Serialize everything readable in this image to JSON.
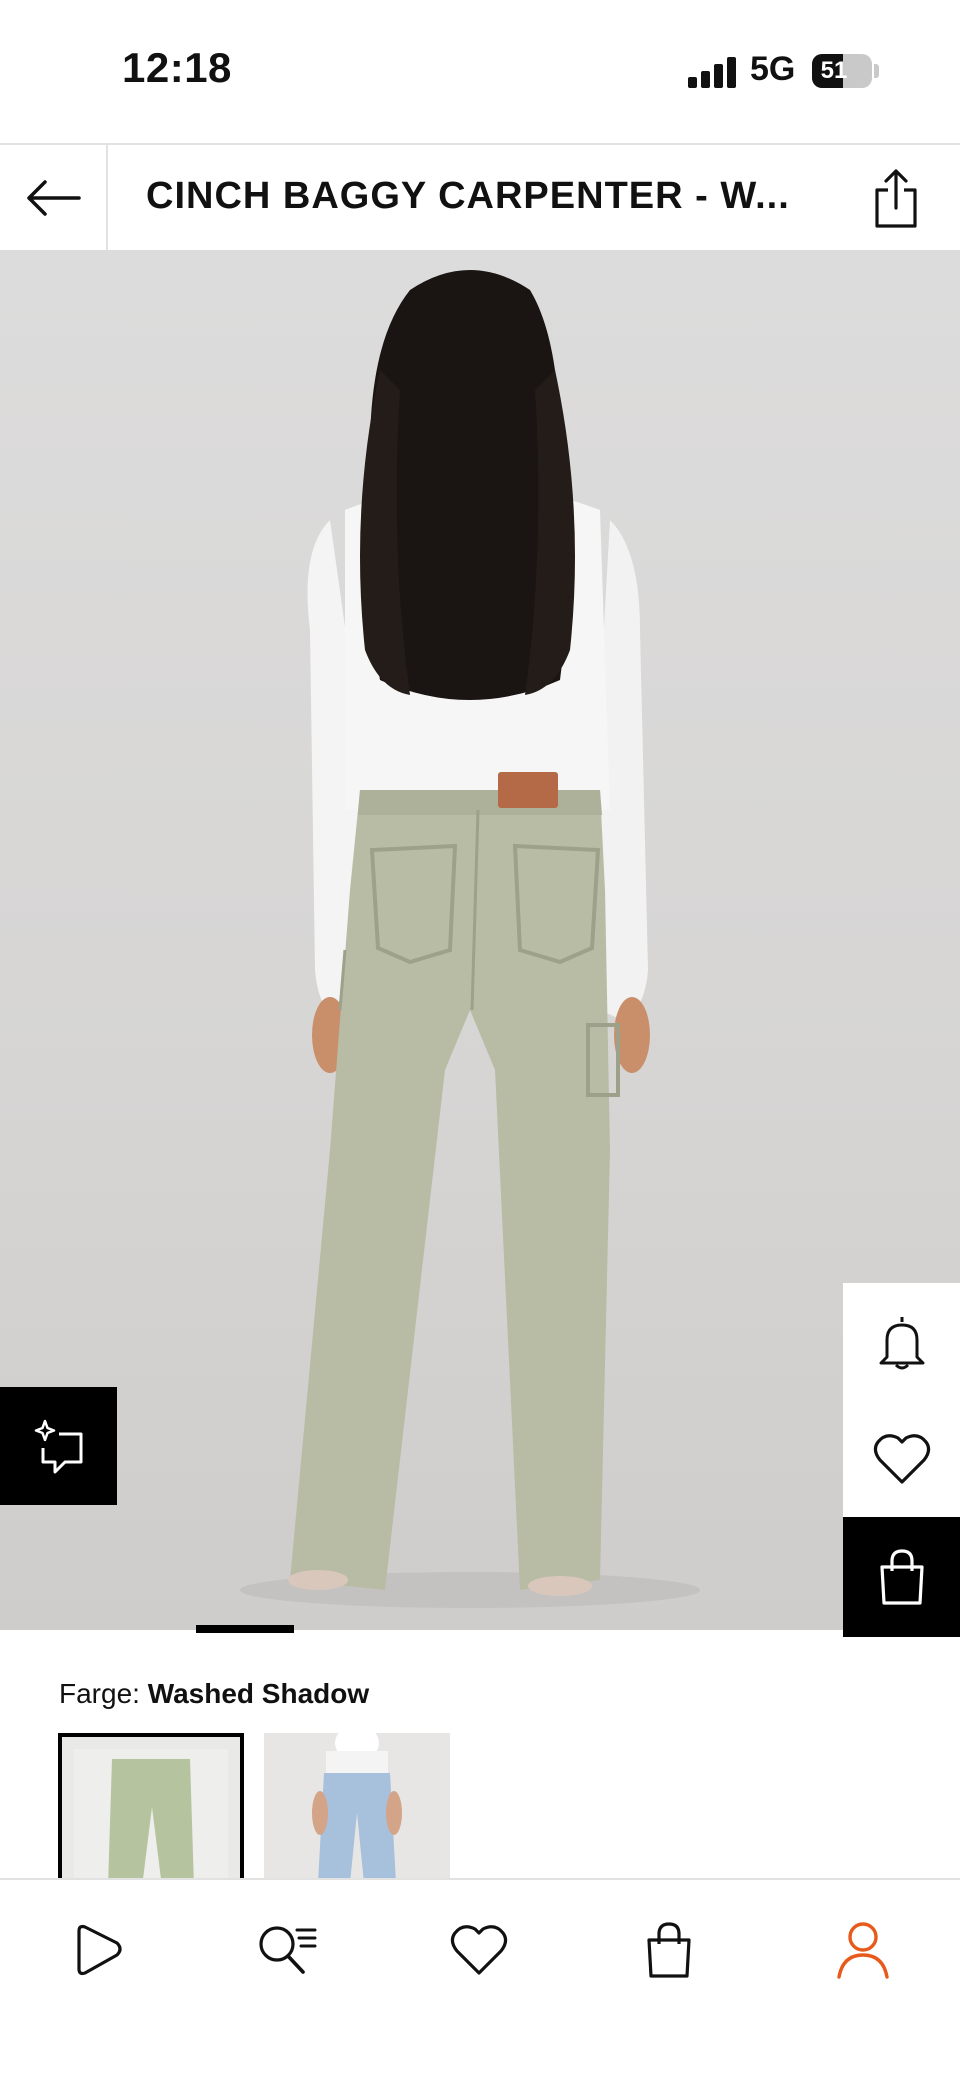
{
  "status_bar": {
    "time": "12:18",
    "network": "5G",
    "battery": "51",
    "battery_level": 0.51,
    "icons": [
      "signal-icon",
      "battery-icon"
    ]
  },
  "header": {
    "title": "CINCH BAGGY CARPENTER - W...",
    "icons": [
      "back-arrow-icon",
      "share-icon"
    ]
  },
  "gallery": {
    "image_index": 1,
    "image_count": 6
  },
  "side_actions": {
    "icons": [
      "bell-icon",
      "heart-icon",
      "shopping-bag-icon"
    ]
  },
  "compare": {
    "icon": "sparkle-compare-icon"
  },
  "color": {
    "label": "Farge:",
    "value": "Washed Shadow",
    "swatches": [
      {
        "selected": true
      },
      {
        "selected": false
      }
    ]
  },
  "bottom_nav": {
    "items": [
      {
        "icon": "play-icon"
      },
      {
        "icon": "search-list-icon"
      },
      {
        "icon": "heart-icon"
      },
      {
        "icon": "shopping-bag-icon"
      },
      {
        "icon": "user-icon",
        "active": true
      }
    ]
  },
  "colors": {
    "accent": "#e85a1c",
    "text": "#111111",
    "divider": "#e2e2e2",
    "pants": "#b9bca4"
  }
}
